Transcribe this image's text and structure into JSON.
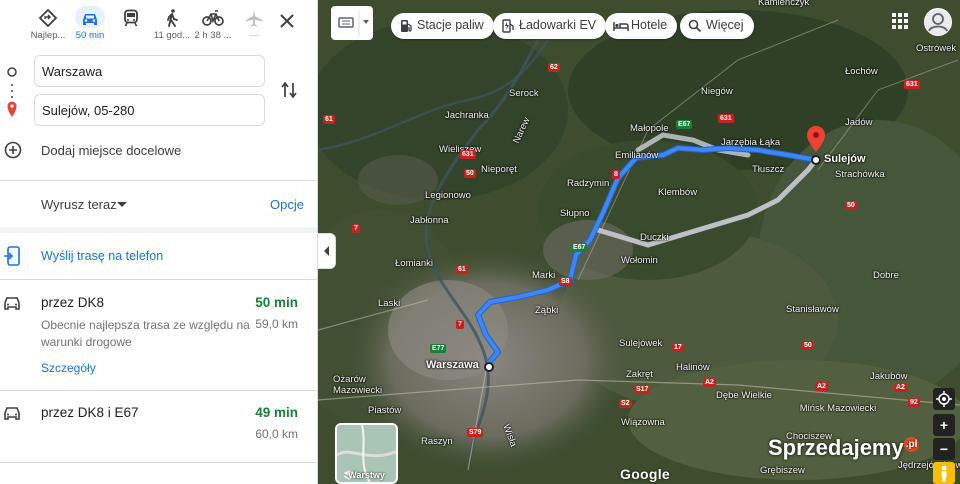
{
  "modes": [
    {
      "icon": "directions-diamond-icon",
      "label": "Najlep..."
    },
    {
      "icon": "car-icon",
      "label": "50 min",
      "active": true
    },
    {
      "icon": "train-icon",
      "label": ""
    },
    {
      "icon": "walking-icon",
      "label": "11 god..."
    },
    {
      "icon": "bicycle-icon",
      "label": "2 h 38 ..."
    },
    {
      "icon": "plane-icon",
      "label": "—"
    }
  ],
  "origin": {
    "value": "Warszawa"
  },
  "destination": {
    "value": "Sulejów, 05-280"
  },
  "add_stop_label": "Dodaj miejsce docelowe",
  "depart_label": "Wyrusz teraz",
  "options_label": "Opcje",
  "send_label": "Wyślij trasę na telefon",
  "routes": [
    {
      "via": "przez DK8",
      "time": "50 min",
      "desc": "Obecnie najlepsza trasa ze względu na warunki drogowe",
      "dist": "59,0 km",
      "details": "Szczegóły"
    },
    {
      "via": "przez DK8 i E67",
      "time": "49 min",
      "desc": "",
      "dist": "60,0 km",
      "details": ""
    }
  ],
  "chips": [
    {
      "icon": "gas-station-icon",
      "label": "Stacje paliw"
    },
    {
      "icon": "ev-charger-icon",
      "label": "Ładowarki EV"
    },
    {
      "icon": "hotel-icon",
      "label": "Hotele"
    },
    {
      "icon": "search-icon",
      "label": "Więcej"
    }
  ],
  "map": {
    "origin_label": "Warszawa",
    "destination_label": "Sulejów",
    "places": [
      {
        "name": "Kamieńczyk",
        "cls": ""
      },
      {
        "name": "Ostrówek",
        "cls": ""
      },
      {
        "name": "Łochów",
        "cls": ""
      },
      {
        "name": "Serock",
        "cls": ""
      },
      {
        "name": "Niegów",
        "cls": ""
      },
      {
        "name": "Jachranka",
        "cls": ""
      },
      {
        "name": "Małopole",
        "cls": ""
      },
      {
        "name": "Jarzębia Łąka",
        "cls": ""
      },
      {
        "name": "Jadów",
        "cls": ""
      },
      {
        "name": "Wieliszew",
        "cls": ""
      },
      {
        "name": "Emilianów",
        "cls": ""
      },
      {
        "name": "Tłuszcz",
        "cls": ""
      },
      {
        "name": "Strachówka",
        "cls": ""
      },
      {
        "name": "Nieporęt",
        "cls": ""
      },
      {
        "name": "Radzymin",
        "cls": ""
      },
      {
        "name": "Klembów",
        "cls": ""
      },
      {
        "name": "Legionowo",
        "cls": ""
      },
      {
        "name": "Jabłonna",
        "cls": ""
      },
      {
        "name": "Słupno",
        "cls": ""
      },
      {
        "name": "Duczki",
        "cls": ""
      },
      {
        "name": "Łomianki",
        "cls": ""
      },
      {
        "name": "Wołomin",
        "cls": ""
      },
      {
        "name": "Dobre",
        "cls": ""
      },
      {
        "name": "Marki",
        "cls": ""
      },
      {
        "name": "Laski",
        "cls": ""
      },
      {
        "name": "Ząbki",
        "cls": ""
      },
      {
        "name": "Stanisławów",
        "cls": ""
      },
      {
        "name": "Sulejówek",
        "cls": ""
      },
      {
        "name": "Halinów",
        "cls": ""
      },
      {
        "name": "Zakręt",
        "cls": ""
      },
      {
        "name": "Jakubów",
        "cls": ""
      },
      {
        "name": "Ożarów Mazowiecki",
        "cls": ""
      },
      {
        "name": "Dębe Wielkie",
        "cls": ""
      },
      {
        "name": "Mińsk Mazowiecki",
        "cls": ""
      },
      {
        "name": "Piastów",
        "cls": ""
      },
      {
        "name": "Wiązowna",
        "cls": ""
      },
      {
        "name": "Raszyn",
        "cls": ""
      },
      {
        "name": "Chociszew",
        "cls": ""
      },
      {
        "name": "Grębiszew",
        "cls": ""
      },
      {
        "name": "Narew",
        "cls": ""
      },
      {
        "name": "Wisła",
        "cls": ""
      },
      {
        "name": "Jędrzejów Nowy",
        "cls": ""
      }
    ],
    "road_badges": [
      "61",
      "62",
      "E67",
      "8",
      "7",
      "E67",
      "631",
      "61",
      "50",
      "50",
      "631",
      "S8",
      "S2",
      "A2",
      "A2",
      "A2",
      "92",
      "17",
      "S17",
      "S79",
      "7",
      "E77",
      "631",
      "50"
    ],
    "layers_label": "Warstwy",
    "google_label": "Google",
    "watermark": "Sprzedajemy",
    "watermark_suffix": ".pl",
    "zoom_in": "+",
    "zoom_out": "−"
  },
  "colors": {
    "accent": "#1a73e8",
    "route_primary": "#4285f4",
    "route_alt": "#bdc1c6",
    "time_green": "#188038",
    "pin_red": "#ea4335"
  }
}
